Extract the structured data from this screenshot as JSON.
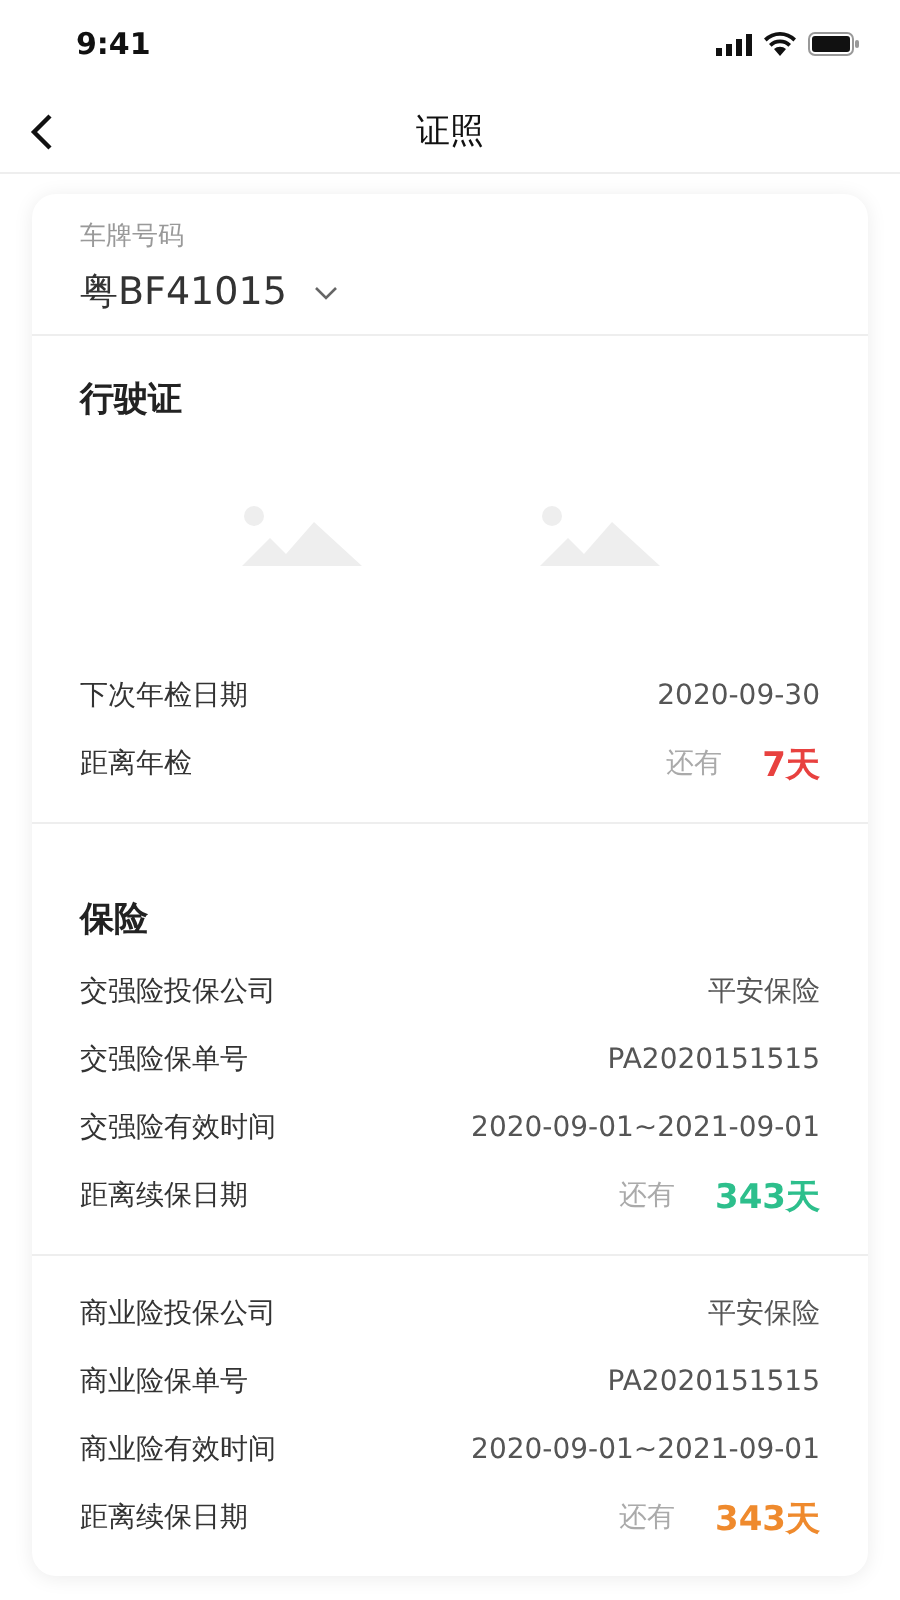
{
  "status_bar": {
    "time": "9:41"
  },
  "nav": {
    "title": "证照"
  },
  "plate": {
    "label": "车牌号码",
    "value": "粤BF41015"
  },
  "sections": [
    {
      "title": "行驶证",
      "photos": [
        {
          "kind": "placeholder"
        },
        {
          "kind": "placeholder"
        }
      ],
      "groups": [
        [
          {
            "kind": "text",
            "label": "下次年检日期",
            "value": "2020-09-30"
          },
          {
            "kind": "countdown",
            "label": "距离年检",
            "prefix": "还有",
            "value": "7天",
            "color": "#e8413f"
          }
        ]
      ]
    },
    {
      "title": "保险",
      "groups": [
        [
          {
            "kind": "text",
            "label": "交强险投保公司",
            "value": "平安保险"
          },
          {
            "kind": "text",
            "label": "交强险保单号",
            "value": "PA2020151515"
          },
          {
            "kind": "text",
            "label": "交强险有效时间",
            "value": "2020-09-01~2021-09-01"
          },
          {
            "kind": "countdown",
            "label": "距离续保日期",
            "prefix": "还有",
            "value": "343天",
            "color": "#2dbf8c"
          }
        ],
        [
          {
            "kind": "text",
            "label": "商业险投保公司",
            "value": "平安保险"
          },
          {
            "kind": "text",
            "label": "商业险保单号",
            "value": "PA2020151515"
          },
          {
            "kind": "text",
            "label": "商业险有效时间",
            "value": "2020-09-01~2021-09-01"
          },
          {
            "kind": "countdown",
            "label": "距离续保日期",
            "prefix": "还有",
            "value": "343天",
            "color": "#ef8a2d"
          }
        ]
      ]
    }
  ]
}
